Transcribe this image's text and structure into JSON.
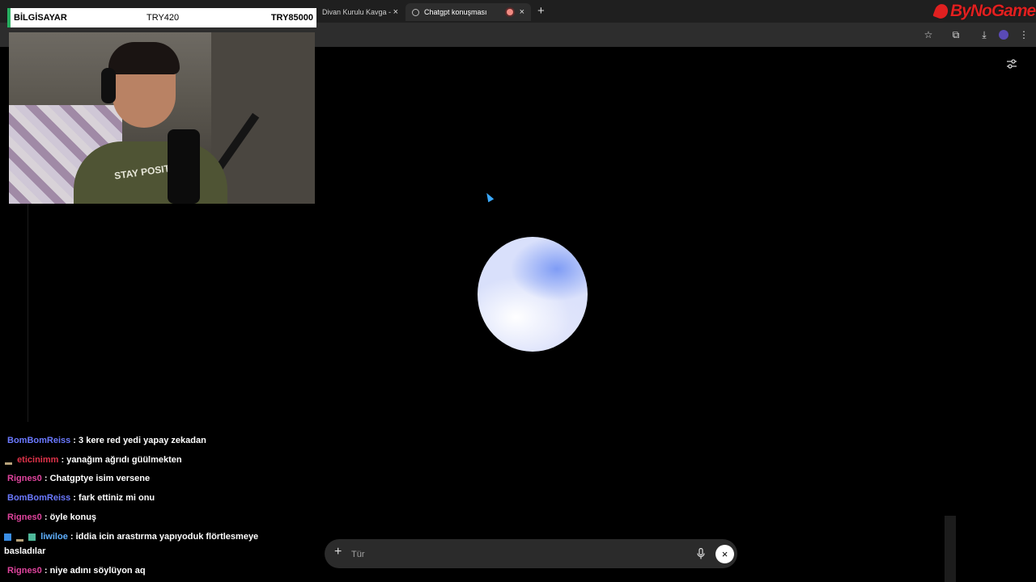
{
  "browser": {
    "tabs": [
      {
        "title": "Divan Kurulu Kavga - G"
      },
      {
        "title": "Chatgpt konuşması"
      }
    ],
    "new_tab_glyph": "+",
    "close_glyph": "×"
  },
  "brand": {
    "name": "ByNoGame"
  },
  "donation": {
    "name": "BİLGİSAYAR",
    "amount": "TRY420",
    "goal": "TRY85000"
  },
  "webcam": {
    "shirt_text": "STAY POSIT"
  },
  "chat": {
    "messages": [
      {
        "user": "BomBomReiss",
        "text": " : 3 kere red yedi yapay zekadan",
        "color": "#6b79ff"
      },
      {
        "user": "eticinimm",
        "text": " : yanağım ağrıdı güülmekten",
        "color": "#e0334a"
      },
      {
        "user": "Rignes0",
        "text": " : Chatgptye isim versene",
        "color": "#e0449e"
      },
      {
        "user": "BomBomReiss",
        "text": " : fark ettiniz mi onu",
        "color": "#6b79ff"
      },
      {
        "user": "Rignes0",
        "text": " : öyle konuş",
        "color": "#e0449e"
      },
      {
        "user": "liwiloe",
        "text": " : iddia icin arastırma yapıyoduk flörtlesmeye",
        "color": "#5fb0ff"
      },
      {
        "user": "",
        "text": "basladılar",
        "color": "#ffffff"
      },
      {
        "user": "Rignes0",
        "text": " : niye adını söylüyon aq",
        "color": "#e0449e"
      }
    ]
  },
  "input": {
    "placeholder": "Tür"
  },
  "icons": {
    "settings": "sliders-icon",
    "star": "star-icon",
    "mic": "mic-icon",
    "close": "close-icon"
  }
}
